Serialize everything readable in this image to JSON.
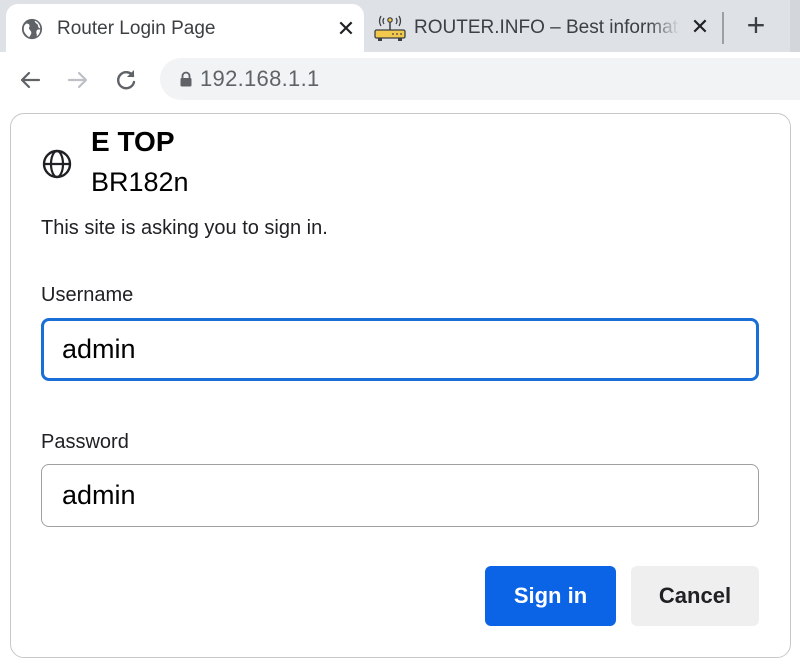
{
  "browser": {
    "tabs": [
      {
        "title": "Router Login Page",
        "favicon": "globe-icon",
        "active": true
      },
      {
        "title": "ROUTER.INFO – Best information",
        "favicon": "router-icon",
        "active": false
      }
    ],
    "close_glyph": "✕",
    "new_tab_glyph": "+",
    "address_bar": {
      "url": "192.168.1.1",
      "security_icon": "lock-icon"
    },
    "nav": {
      "back": "back-arrow-icon",
      "forward": "forward-arrow-icon",
      "reload": "reload-icon"
    }
  },
  "dialog": {
    "site_name": "E TOP",
    "site_subtitle": "BR182n",
    "prompt": "This site is asking you to sign in.",
    "username": {
      "label": "Username",
      "value": "admin"
    },
    "password": {
      "label": "Password",
      "value": "admin"
    },
    "buttons": {
      "sign_in": "Sign in",
      "cancel": "Cancel"
    }
  },
  "colors": {
    "accent": "#0b63e5",
    "focus_border": "#1a6fd6",
    "tabstrip_bg": "#dee1e6",
    "omnibox_bg": "#f1f3f4",
    "router_icon_yellow": "#f2c94c"
  }
}
